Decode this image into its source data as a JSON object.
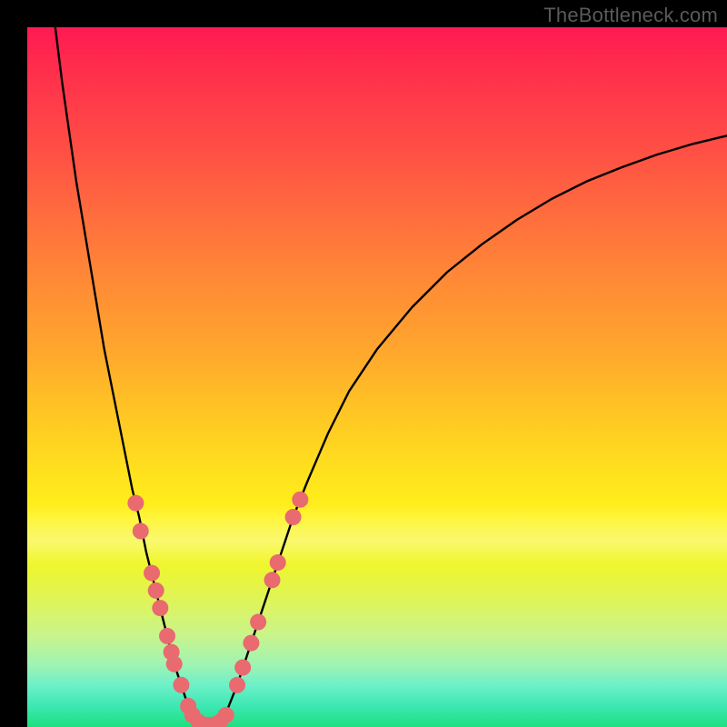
{
  "watermark": "TheBottleneck.com",
  "colors": {
    "frame_bg": "#000000",
    "curve_stroke": "#000000",
    "marker_fill": "#e96a6f",
    "marker_stroke": "#d85a60"
  },
  "chart_data": {
    "type": "line",
    "title": "",
    "xlabel": "",
    "ylabel": "",
    "xlim": [
      0,
      100
    ],
    "ylim": [
      0,
      100
    ],
    "annotations": [],
    "series": [
      {
        "name": "left-branch",
        "x": [
          4,
          5,
          6,
          7,
          8,
          9,
          10,
          11,
          12,
          13,
          14,
          15,
          16,
          17,
          18,
          19,
          20,
          21,
          22,
          23,
          24
        ],
        "y": [
          100,
          92,
          85,
          78,
          72,
          66,
          60,
          54,
          49,
          44,
          39,
          34,
          30,
          25,
          21,
          17,
          13,
          9,
          6,
          3,
          1
        ]
      },
      {
        "name": "valley-floor",
        "x": [
          24,
          25,
          26,
          27,
          28
        ],
        "y": [
          1,
          0.3,
          0.2,
          0.3,
          1
        ]
      },
      {
        "name": "right-branch",
        "x": [
          28,
          30,
          32,
          34,
          36,
          38,
          40,
          43,
          46,
          50,
          55,
          60,
          65,
          70,
          75,
          80,
          85,
          90,
          95,
          100
        ],
        "y": [
          1,
          6,
          12,
          18,
          24,
          30,
          35,
          42,
          48,
          54,
          60,
          65,
          69,
          72.5,
          75.5,
          78,
          80,
          81.8,
          83.3,
          84.5
        ]
      }
    ],
    "markers": {
      "name": "highlighted-points",
      "points": [
        {
          "x": 15.5,
          "y": 32
        },
        {
          "x": 16.2,
          "y": 28
        },
        {
          "x": 17.8,
          "y": 22
        },
        {
          "x": 18.4,
          "y": 19.5
        },
        {
          "x": 19.0,
          "y": 17
        },
        {
          "x": 20.0,
          "y": 13
        },
        {
          "x": 20.6,
          "y": 10.7
        },
        {
          "x": 21.0,
          "y": 9
        },
        {
          "x": 22.0,
          "y": 6
        },
        {
          "x": 23.0,
          "y": 3
        },
        {
          "x": 23.6,
          "y": 1.7
        },
        {
          "x": 24.5,
          "y": 0.7
        },
        {
          "x": 25.5,
          "y": 0.3
        },
        {
          "x": 26.5,
          "y": 0.3
        },
        {
          "x": 27.5,
          "y": 0.7
        },
        {
          "x": 28.4,
          "y": 1.7
        },
        {
          "x": 30.0,
          "y": 6
        },
        {
          "x": 30.8,
          "y": 8.5
        },
        {
          "x": 32.0,
          "y": 12
        },
        {
          "x": 33.0,
          "y": 15
        },
        {
          "x": 35.0,
          "y": 21
        },
        {
          "x": 35.8,
          "y": 23.5
        },
        {
          "x": 38.0,
          "y": 30
        },
        {
          "x": 39.0,
          "y": 32.5
        }
      ]
    }
  }
}
